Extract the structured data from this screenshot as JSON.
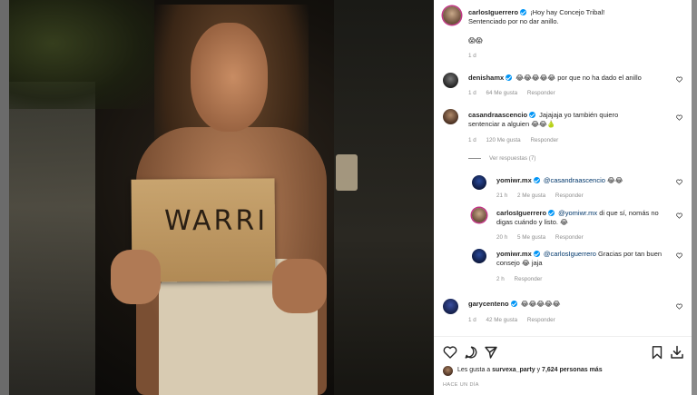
{
  "photo": {
    "card_text": "WARRI"
  },
  "caption": {
    "username": "carlosIguerrero",
    "line1": "¡Hoy hay Concejo Tribal!",
    "line2": "Sentenciado por no dar anillo.",
    "emojis": "😱😱",
    "time": "1 d"
  },
  "comments": [
    {
      "username": "denishamx",
      "emojis": "😂😂😂😂😂",
      "text": "por que no ha dado el anillo",
      "time": "1 d",
      "likes": "64 Me gusta",
      "reply": "Responder"
    },
    {
      "username": "casandraascencio",
      "text": "Jajajaja yo también quiero sentenciar a alguien",
      "emojis": "😂😂🍐",
      "time": "1 d",
      "likes": "120 Me gusta",
      "reply": "Responder",
      "view_replies": "Ver respuestas (7)"
    }
  ],
  "replies": [
    {
      "username": "yomiwr.mx",
      "mention": "@casandraascencio",
      "text": "",
      "emojis": "😂😂",
      "time": "21 h",
      "likes": "2 Me gusta",
      "reply": "Responder"
    },
    {
      "username": "carlosIguerrero",
      "mention": "@yomiwr.mx",
      "text": "di que sí, nomás no digas cuándo y listo.",
      "emojis": "😂",
      "time": "20 h",
      "likes": "5 Me gusta",
      "reply": "Responder"
    },
    {
      "username": "yomiwr.mx",
      "mention": "@carlosIguerrero",
      "text": "Gracias por tan buen consejo",
      "emojis": "😂",
      "trailing": "jaja",
      "time": "2 h",
      "reply": "Responder"
    }
  ],
  "last_comment": {
    "username": "garycenteno",
    "emojis": "😂😂😂😂😂",
    "time": "1 d",
    "likes": "42 Me gusta",
    "reply": "Responder"
  },
  "footer": {
    "likes_prefix": "Les gusta a",
    "likes_user": "survexa_party",
    "likes_middle": "y",
    "likes_count": "7,624 personas más",
    "date": "HACE UN DÍA"
  },
  "icons": {
    "like": "heart-icon",
    "comment": "comment-icon",
    "share": "paper-plane-icon",
    "save": "bookmark-icon",
    "download": "download-icon"
  },
  "colors": {
    "verified": "#0095f6",
    "mention": "#00376b",
    "meta": "#8e8e8e"
  }
}
